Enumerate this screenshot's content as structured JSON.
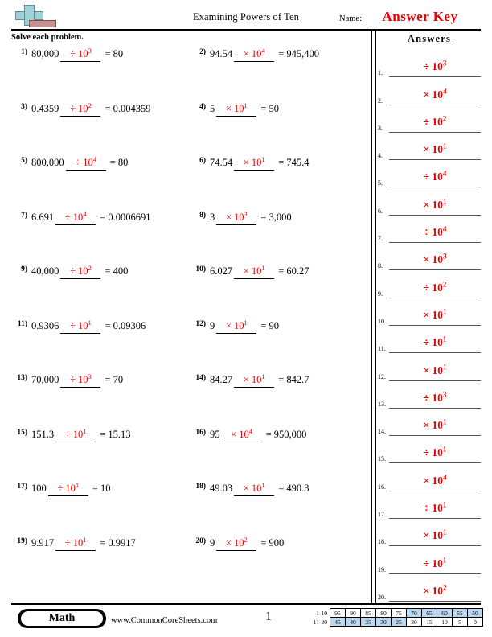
{
  "header": {
    "logo_icon": "plus-block-logo",
    "title": "Examining Powers of Ten",
    "name_label": "Name:",
    "answer_key": "Answer Key",
    "instructions": "Solve each problem.",
    "answer_key_color": "#ee0000"
  },
  "answers_column": {
    "heading": "Answers",
    "items": [
      {
        "num": "1.",
        "value": "÷ 10",
        "exp": "3"
      },
      {
        "num": "2.",
        "value": "× 10",
        "exp": "4"
      },
      {
        "num": "3.",
        "value": "÷ 10",
        "exp": "2"
      },
      {
        "num": "4.",
        "value": "× 10",
        "exp": "1"
      },
      {
        "num": "5.",
        "value": "÷ 10",
        "exp": "4"
      },
      {
        "num": "6.",
        "value": "× 10",
        "exp": "1"
      },
      {
        "num": "7.",
        "value": "÷ 10",
        "exp": "4"
      },
      {
        "num": "8.",
        "value": "× 10",
        "exp": "3"
      },
      {
        "num": "9.",
        "value": "÷ 10",
        "exp": "2"
      },
      {
        "num": "10.",
        "value": "× 10",
        "exp": "1"
      },
      {
        "num": "11.",
        "value": "÷ 10",
        "exp": "1"
      },
      {
        "num": "12.",
        "value": "× 10",
        "exp": "1"
      },
      {
        "num": "13.",
        "value": "÷ 10",
        "exp": "3"
      },
      {
        "num": "14.",
        "value": "× 10",
        "exp": "1"
      },
      {
        "num": "15.",
        "value": "÷ 10",
        "exp": "1"
      },
      {
        "num": "16.",
        "value": "× 10",
        "exp": "4"
      },
      {
        "num": "17.",
        "value": "÷ 10",
        "exp": "1"
      },
      {
        "num": "18.",
        "value": "× 10",
        "exp": "1"
      },
      {
        "num": "19.",
        "value": "÷ 10",
        "exp": "1"
      },
      {
        "num": "20.",
        "value": "× 10",
        "exp": "2"
      }
    ]
  },
  "problems": [
    {
      "num": "1)",
      "left": "80,000",
      "op": "÷ 10",
      "exp": "3",
      "right": "= 80"
    },
    {
      "num": "2)",
      "left": "94.54",
      "op": "× 10",
      "exp": "4",
      "right": "= 945,400"
    },
    {
      "num": "3)",
      "left": "0.4359",
      "op": "÷ 10",
      "exp": "2",
      "right": "= 0.004359"
    },
    {
      "num": "4)",
      "left": "5",
      "op": "× 10",
      "exp": "1",
      "right": "= 50"
    },
    {
      "num": "5)",
      "left": "800,000",
      "op": "÷ 10",
      "exp": "4",
      "right": "= 80"
    },
    {
      "num": "6)",
      "left": "74.54",
      "op": "× 10",
      "exp": "1",
      "right": "= 745.4"
    },
    {
      "num": "7)",
      "left": "6.691",
      "op": "÷ 10",
      "exp": "4",
      "right": "= 0.0006691"
    },
    {
      "num": "8)",
      "left": "3",
      "op": "× 10",
      "exp": "3",
      "right": "= 3,000"
    },
    {
      "num": "9)",
      "left": "40,000",
      "op": "÷ 10",
      "exp": "2",
      "right": "= 400"
    },
    {
      "num": "10)",
      "left": "6.027",
      "op": "× 10",
      "exp": "1",
      "right": "= 60.27"
    },
    {
      "num": "11)",
      "left": "0.9306",
      "op": "÷ 10",
      "exp": "1",
      "right": "= 0.09306"
    },
    {
      "num": "12)",
      "left": "9",
      "op": "× 10",
      "exp": "1",
      "right": "= 90"
    },
    {
      "num": "13)",
      "left": "70,000",
      "op": "÷ 10",
      "exp": "3",
      "right": "= 70"
    },
    {
      "num": "14)",
      "left": "84.27",
      "op": "× 10",
      "exp": "1",
      "right": "= 842.7"
    },
    {
      "num": "15)",
      "left": "151.3",
      "op": "÷ 10",
      "exp": "1",
      "right": "= 15.13"
    },
    {
      "num": "16)",
      "left": "95",
      "op": "× 10",
      "exp": "4",
      "right": "= 950,000"
    },
    {
      "num": "17)",
      "left": "100",
      "op": "÷ 10",
      "exp": "1",
      "right": "= 10"
    },
    {
      "num": "18)",
      "left": "49.03",
      "op": "× 10",
      "exp": "1",
      "right": "= 490.3"
    },
    {
      "num": "19)",
      "left": "9.917",
      "op": "÷ 10",
      "exp": "1",
      "right": "= 0.9917"
    },
    {
      "num": "20)",
      "left": "9",
      "op": "× 10",
      "exp": "2",
      "right": "= 900"
    }
  ],
  "footer": {
    "subject_badge": "Math",
    "website": "www.CommonCoreSheets.com",
    "page_number": "1",
    "scale": {
      "row1_label": "1-10",
      "row2_label": "11-20",
      "row1": [
        {
          "v": "95",
          "hl": false
        },
        {
          "v": "90",
          "hl": false
        },
        {
          "v": "85",
          "hl": false
        },
        {
          "v": "80",
          "hl": false
        },
        {
          "v": "75",
          "hl": false
        },
        {
          "v": "70",
          "hl": true
        },
        {
          "v": "65",
          "hl": true
        },
        {
          "v": "60",
          "hl": true
        },
        {
          "v": "55",
          "hl": true
        },
        {
          "v": "50",
          "hl": true
        }
      ],
      "row2": [
        {
          "v": "45",
          "hl": true
        },
        {
          "v": "40",
          "hl": true
        },
        {
          "v": "35",
          "hl": true
        },
        {
          "v": "30",
          "hl": true
        },
        {
          "v": "25",
          "hl": true
        },
        {
          "v": "20",
          "hl": false
        },
        {
          "v": "15",
          "hl": false
        },
        {
          "v": "10",
          "hl": false
        },
        {
          "v": "5",
          "hl": false
        },
        {
          "v": "0",
          "hl": false
        }
      ],
      "highlight_color": "#bdd7ee"
    }
  }
}
